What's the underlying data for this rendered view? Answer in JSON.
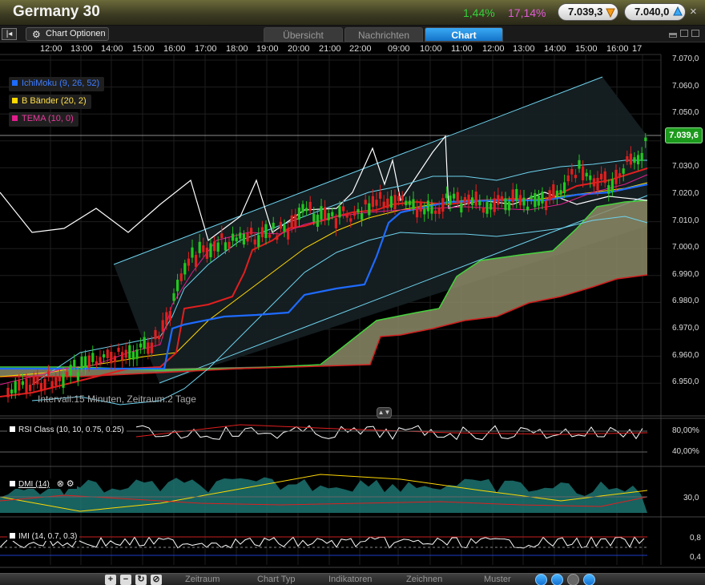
{
  "header": {
    "title": "Germany 30",
    "change_pct": "1,44%",
    "change_pct2": "17,14%",
    "bid": "7.039,3",
    "ask": "7.040,0",
    "close": "×"
  },
  "toolbar": {
    "chart_options": "Chart Optionen",
    "tabs": [
      "Übersicht",
      "Nachrichten",
      "Chart"
    ],
    "active_tab": "Chart"
  },
  "chart": {
    "current_price": "7.039,6",
    "interval_text": "Intervall:15 Minuten, Zeitraum:2 Tage",
    "x_ticks": [
      "12:00",
      "13:00",
      "14:00",
      "15:00",
      "16:00",
      "17:00",
      "18:00",
      "19:00",
      "20:00",
      "21:00",
      "22:00",
      "09:00",
      "10:00",
      "11:00",
      "12:00",
      "13:00",
      "14:00",
      "15:00",
      "16:00",
      "17"
    ],
    "y_ticks": [
      "7.070,0",
      "7.060,0",
      "7.050,0",
      "7.040,0",
      "7.030,0",
      "7.020,0",
      "7.010,0",
      "7.000,0",
      "6.990,0",
      "6.980,0",
      "6.970,0",
      "6.960,0",
      "6.950,0"
    ],
    "legend": [
      {
        "label": "IchiMoku (9, 26, 52)",
        "color": "#1e6bff"
      },
      {
        "label": "B Bänder (20, 2)",
        "color": "#ffd800"
      },
      {
        "label": "TEMA (10, 0)",
        "color": "#e01e8c"
      }
    ],
    "colors": {
      "up": "#22c81e",
      "down": "#e01f1f",
      "channel": "#6ed3ee",
      "cloud": "#8c8a66",
      "white": "#ffffff"
    }
  },
  "indicators": {
    "rsi": {
      "label": "RSI Class (10, 10, 0.75, 0.25)",
      "levels": [
        "80,00%",
        "40,00%"
      ]
    },
    "dmi": {
      "label": "DMI (14)",
      "level": "30,0"
    },
    "imi": {
      "label": "IMI (14, 0.7, 0.3)",
      "levels": [
        "0,8",
        "0,4"
      ]
    }
  },
  "bottombar": {
    "menus": [
      "Zeitraum",
      "Chart Typ",
      "Indikatoren",
      "Zeichnen",
      "Muster"
    ],
    "buttons": [
      "+",
      "−",
      "↻",
      "⊘"
    ]
  }
}
